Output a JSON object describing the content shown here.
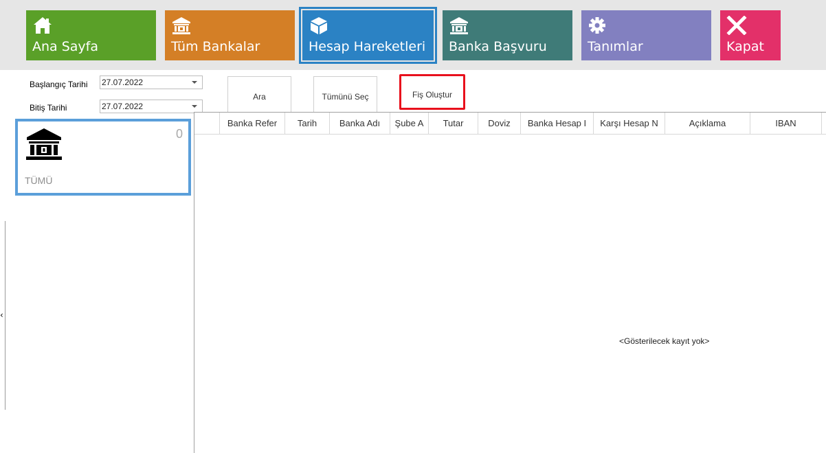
{
  "toolbar": {
    "tiles": [
      {
        "label": "Ana Sayfa",
        "icon": "home-icon",
        "color": "#5aa028"
      },
      {
        "label": "Tüm Bankalar",
        "icon": "bank-icon",
        "color": "#d47f26"
      },
      {
        "label": "Hesap Hareketleri",
        "icon": "cube-icon",
        "color": "#2b82c4"
      },
      {
        "label": "Banka Başvuru",
        "icon": "bank-icon",
        "color": "#3f7b78"
      },
      {
        "label": "Tanımlar",
        "icon": "gear-icon",
        "color": "#8280c0"
      },
      {
        "label": "Kapat",
        "icon": "close-icon",
        "color": "#e33069"
      }
    ]
  },
  "filters": {
    "start_label": "Başlangıç Tarihi",
    "start_value": "27.07.2022",
    "end_label": "Bitiş Tarihi",
    "end_value": "27.07.2022"
  },
  "actions": {
    "search": "Ara",
    "select_all": "Tümünü Seç",
    "create_voucher": "Fiş Oluştur"
  },
  "summary_card": {
    "count": "0",
    "label": "TÜMÜ"
  },
  "grid": {
    "columns": [
      "Banka Refer",
      "Tarih",
      "Banka Adı",
      "Şube A",
      "Tutar",
      "Doviz",
      "Banka Hesap I",
      "Karşı Hesap N",
      "Açıklama",
      "IBAN"
    ],
    "empty_message": "<Gösterilecek kayıt yok>"
  },
  "colors": {
    "active_outline": "#2b82c4",
    "highlight": "#e8101c",
    "card_border": "#5b9fda"
  }
}
